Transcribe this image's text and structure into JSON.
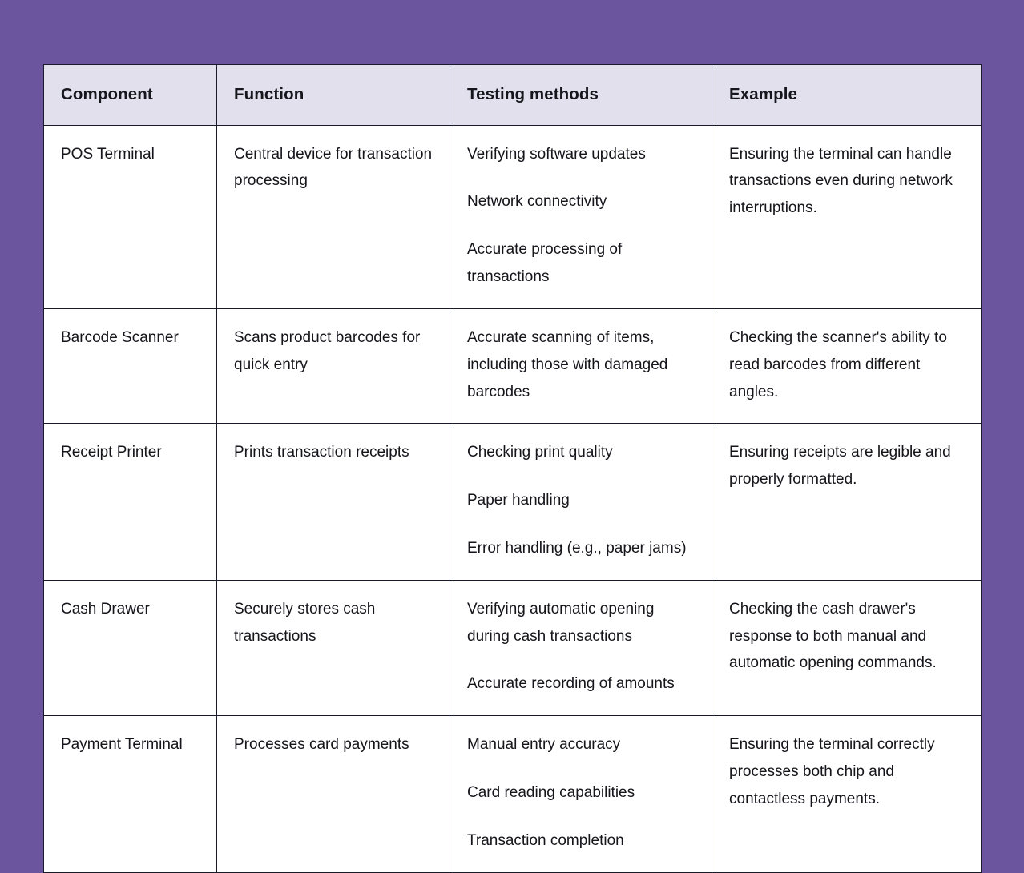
{
  "page": {
    "background_color": "#6b559f",
    "table_border_color": "#1a1a2e",
    "header_background_color": "#e2e0ec",
    "cell_background_color": "#ffffff",
    "text_color": "#15151b"
  },
  "table": {
    "headers": [
      "Component",
      "Function",
      "Testing methods",
      "Example"
    ],
    "rows": [
      {
        "component": "POS Terminal",
        "function": "Central device for transaction processing",
        "testing_methods": [
          "Verifying software updates",
          "Network connectivity",
          "Accurate processing of transactions"
        ],
        "example": "Ensuring the terminal can handle transactions even during network interruptions."
      },
      {
        "component": "Barcode Scanner",
        "function": "Scans product barcodes for quick entry",
        "testing_methods": [
          "Accurate scanning of items, including those with damaged barcodes"
        ],
        "example": "Checking the scanner's ability to read barcodes from different angles."
      },
      {
        "component": "Receipt Printer",
        "function": "Prints transaction receipts",
        "testing_methods": [
          "Checking print quality",
          "Paper handling",
          "Error handling (e.g., paper jams)"
        ],
        "example": "Ensuring receipts are legible and properly formatted."
      },
      {
        "component": "Cash Drawer",
        "function": "Securely stores cash transactions",
        "testing_methods": [
          "Verifying automatic opening during cash transactions",
          "Accurate recording of amounts"
        ],
        "example": "Checking the cash drawer's response to both manual and automatic opening commands."
      },
      {
        "component": "Payment Terminal",
        "function": "Processes card payments",
        "testing_methods": [
          "Manual entry accuracy",
          "Card reading capabilities",
          "Transaction completion"
        ],
        "example": "Ensuring the terminal correctly processes both chip and contactless payments."
      }
    ]
  }
}
